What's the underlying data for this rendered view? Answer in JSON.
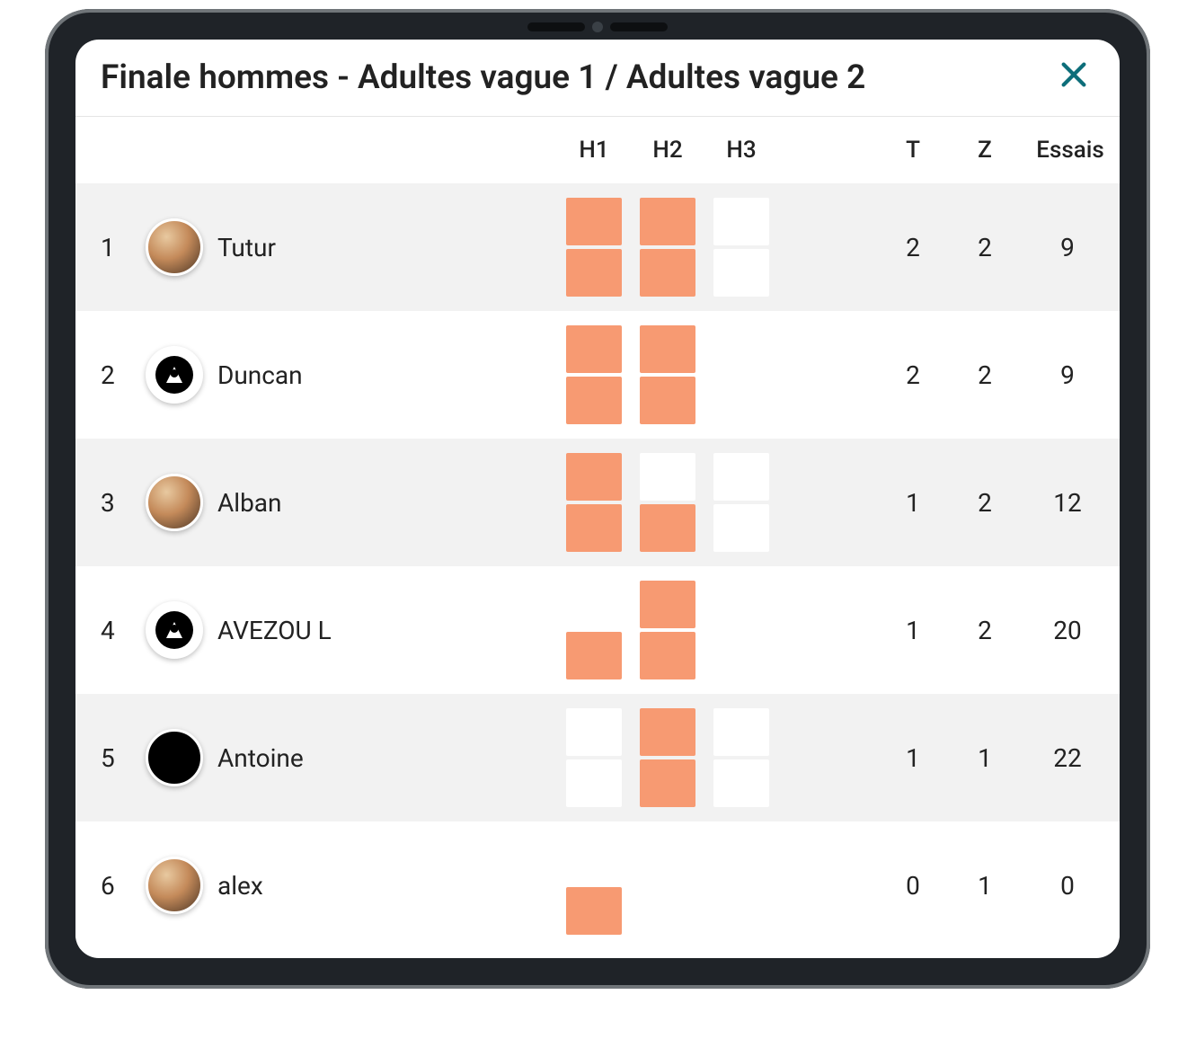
{
  "header": {
    "title": "Finale hommes - Adultes vague 1 / Adultes vague 2",
    "close": "✕"
  },
  "columns": {
    "h1": "H1",
    "h2": "H2",
    "h3": "H3",
    "t": "T",
    "z": "Z",
    "essais": "Essais"
  },
  "rows": [
    {
      "rank": "1",
      "name": "Tutur",
      "avatar": "photo",
      "h": [
        [
          true,
          true
        ],
        [
          true,
          true
        ],
        [
          false,
          false
        ]
      ],
      "t": "2",
      "z": "2",
      "essais": "9"
    },
    {
      "rank": "2",
      "name": "Duncan",
      "avatar": "icon",
      "h": [
        [
          true,
          true
        ],
        [
          true,
          true
        ],
        [
          false,
          false
        ]
      ],
      "t": "2",
      "z": "2",
      "essais": "9"
    },
    {
      "rank": "3",
      "name": "Alban",
      "avatar": "photo",
      "h": [
        [
          true,
          true
        ],
        [
          false,
          true
        ],
        [
          false,
          false
        ]
      ],
      "t": "1",
      "z": "2",
      "essais": "12"
    },
    {
      "rank": "4",
      "name": "AVEZOU L",
      "avatar": "icon",
      "h": [
        [
          false,
          true
        ],
        [
          true,
          true
        ],
        [
          false,
          false
        ]
      ],
      "t": "1",
      "z": "2",
      "essais": "20"
    },
    {
      "rank": "5",
      "name": "Antoine",
      "avatar": "solid",
      "h": [
        [
          false,
          false
        ],
        [
          true,
          true
        ],
        [
          false,
          false
        ]
      ],
      "t": "1",
      "z": "1",
      "essais": "22"
    },
    {
      "rank": "6",
      "name": "alex",
      "avatar": "photo",
      "h": [
        [
          false,
          true
        ],
        [
          false,
          false
        ],
        [
          false,
          false
        ]
      ],
      "t": "0",
      "z": "1",
      "essais": "0"
    }
  ]
}
